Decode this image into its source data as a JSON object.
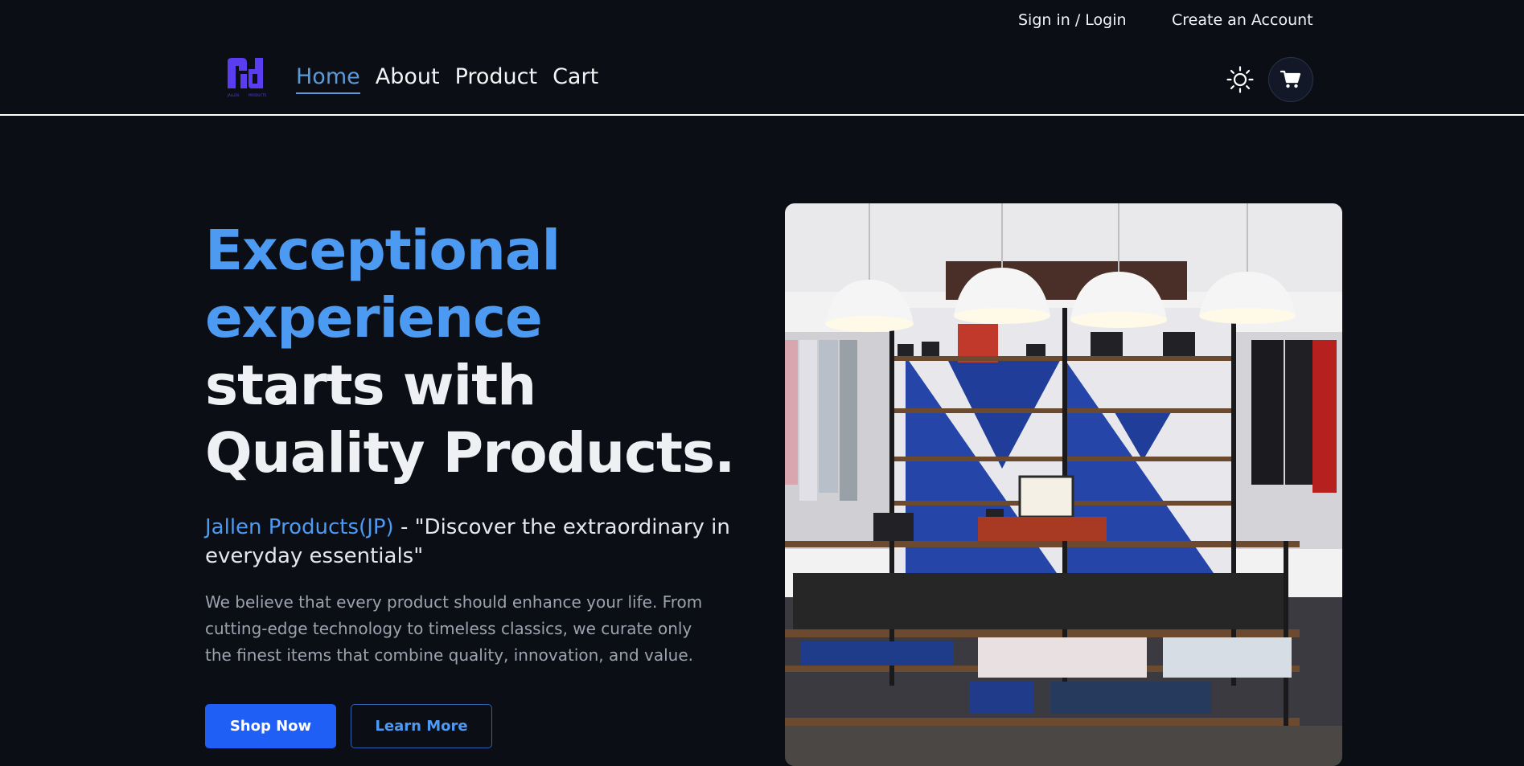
{
  "topbar": {
    "signin_label": "Sign in / Login",
    "create_label": "Create an Account"
  },
  "nav": {
    "logo_text": "JALLEN PRODUCTS",
    "items": [
      {
        "label": "Home",
        "active": true
      },
      {
        "label": "About",
        "active": false
      },
      {
        "label": "Product",
        "active": false
      },
      {
        "label": "Cart",
        "active": false
      }
    ],
    "theme_icon": "sun-icon",
    "cart_icon": "cart-icon"
  },
  "hero": {
    "headline_line1": "Exceptional",
    "headline_line2": "experience",
    "headline_line3": "starts with",
    "headline_line4": "Quality Products.",
    "brand": "Jallen Products(JP)",
    "tagline_rest": " - \"Discover the extraordinary in everyday essentials\"",
    "description": "We believe that every product should enhance your life. From cutting-edge technology to timeless classics, we curate only the finest items that combine quality, innovation, and value.",
    "shop_now_label": "Shop Now",
    "learn_more_label": "Learn More",
    "image_alt": "Clothing store interior with shelves and pendant lamps"
  },
  "colors": {
    "background": "#0b0e15",
    "accent_blue": "#4d9af3",
    "primary_button": "#1f5ff5",
    "nav_active": "#5b9ad8",
    "logo_purple": "#5a3df0"
  }
}
